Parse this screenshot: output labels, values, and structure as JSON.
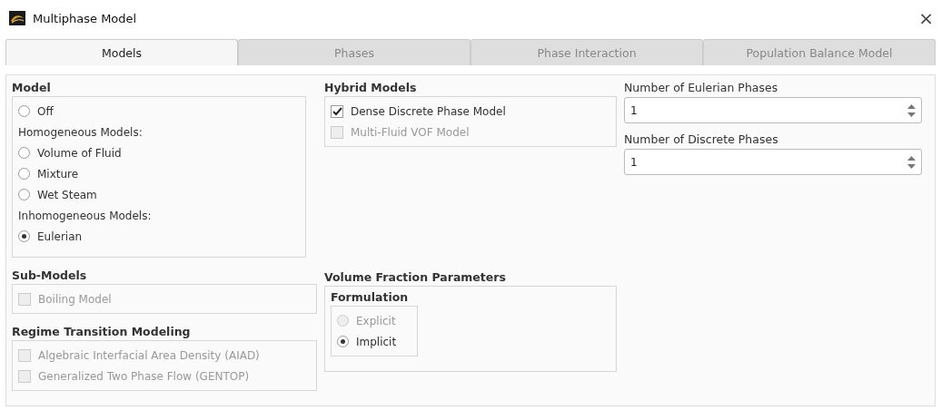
{
  "window": {
    "title": "Multiphase Model",
    "close": "×"
  },
  "tabs": [
    {
      "label": "Models",
      "selected": true
    },
    {
      "label": "Phases",
      "selected": false
    },
    {
      "label": "Phase Interaction",
      "selected": false
    },
    {
      "label": "Population Balance Model",
      "selected": false
    }
  ],
  "model": {
    "heading": "Model",
    "items": [
      {
        "kind": "radio",
        "label": "Off",
        "selected": false,
        "disabled": false
      },
      {
        "kind": "label",
        "label": "Homogeneous Models:"
      },
      {
        "kind": "radio",
        "label": "Volume of Fluid",
        "selected": false,
        "disabled": false
      },
      {
        "kind": "radio",
        "label": "Mixture",
        "selected": false,
        "disabled": false
      },
      {
        "kind": "radio",
        "label": "Wet Steam",
        "selected": false,
        "disabled": false
      },
      {
        "kind": "label",
        "label": "Inhomogeneous Models:"
      },
      {
        "kind": "radio",
        "label": "Eulerian",
        "selected": true,
        "disabled": false
      }
    ]
  },
  "sub_models": {
    "heading": "Sub-Models",
    "items": [
      {
        "label": "Boiling Model",
        "checked": false,
        "disabled": true
      }
    ]
  },
  "regime_transition": {
    "heading": "Regime Transition Modeling",
    "items": [
      {
        "label": "Algebraic Interfacial Area Density (AIAD)",
        "checked": false,
        "disabled": true
      },
      {
        "label": "Generalized Two Phase Flow (GENTOP)",
        "checked": false,
        "disabled": true
      }
    ]
  },
  "hybrid_models": {
    "heading": "Hybrid Models",
    "items": [
      {
        "label": "Dense Discrete Phase Model",
        "checked": true,
        "disabled": false
      },
      {
        "label": "Multi-Fluid VOF Model",
        "checked": false,
        "disabled": true
      }
    ]
  },
  "volume_fraction": {
    "heading": "Volume Fraction Parameters",
    "formulation": {
      "heading": "Formulation",
      "items": [
        {
          "label": "Explicit",
          "selected": false,
          "disabled": true
        },
        {
          "label": "Implicit",
          "selected": true,
          "disabled": false
        }
      ]
    }
  },
  "phase_counts": [
    {
      "label": "Number of Eulerian Phases",
      "value": "1"
    },
    {
      "label": "Number of Discrete Phases",
      "value": "1"
    }
  ]
}
